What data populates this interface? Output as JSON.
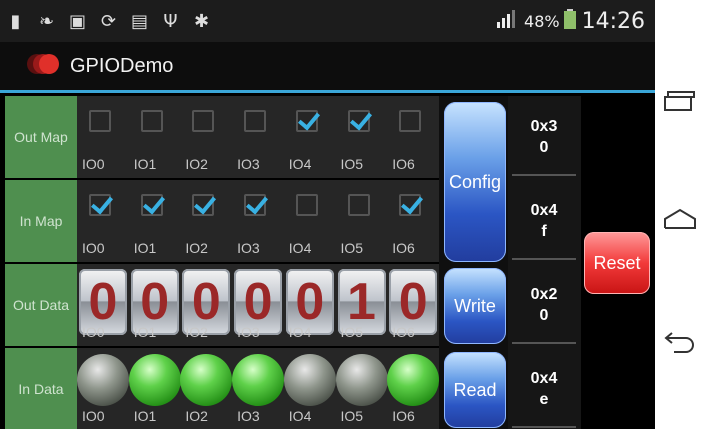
{
  "status_bar": {
    "battery": "48%",
    "time": "14:26",
    "icons": [
      "usb-icon",
      "leaf-icon",
      "image-icon",
      "sync-icon",
      "message-icon",
      "usb-debug-icon",
      "android-icon"
    ]
  },
  "app": {
    "title": "GPIODemo"
  },
  "rows": [
    {
      "label": "Out Map",
      "type": "checkbox",
      "checked": [
        false,
        false,
        false,
        false,
        true,
        true,
        false
      ]
    },
    {
      "label": "In Map",
      "type": "checkbox",
      "checked": [
        true,
        true,
        true,
        true,
        false,
        false,
        true
      ]
    },
    {
      "label": "Out Data",
      "type": "digit",
      "digits": [
        "0",
        "0",
        "0",
        "0",
        "0",
        "1",
        "0"
      ]
    },
    {
      "label": "In Data",
      "type": "led",
      "on": [
        false,
        true,
        true,
        true,
        false,
        false,
        true
      ]
    }
  ],
  "io_labels": [
    "IO0",
    "IO1",
    "IO2",
    "IO3",
    "IO4",
    "IO5",
    "IO6"
  ],
  "buttons": {
    "config": "Config",
    "write": "Write",
    "read": "Read",
    "reset": "Reset"
  },
  "hex_values": [
    "0x3\n0",
    "0x4\nf",
    "0x2\n0",
    "0x4\ne"
  ],
  "colors": {
    "accent": "#3aa6d8",
    "row_label_bg": "#4f8f4f",
    "checkbox_check": "#39b1e3",
    "digit_red": "#9b2828",
    "reset_red": "#f23a3a",
    "button_blue": "#2b56c4",
    "led_green": "#5fd14a"
  }
}
